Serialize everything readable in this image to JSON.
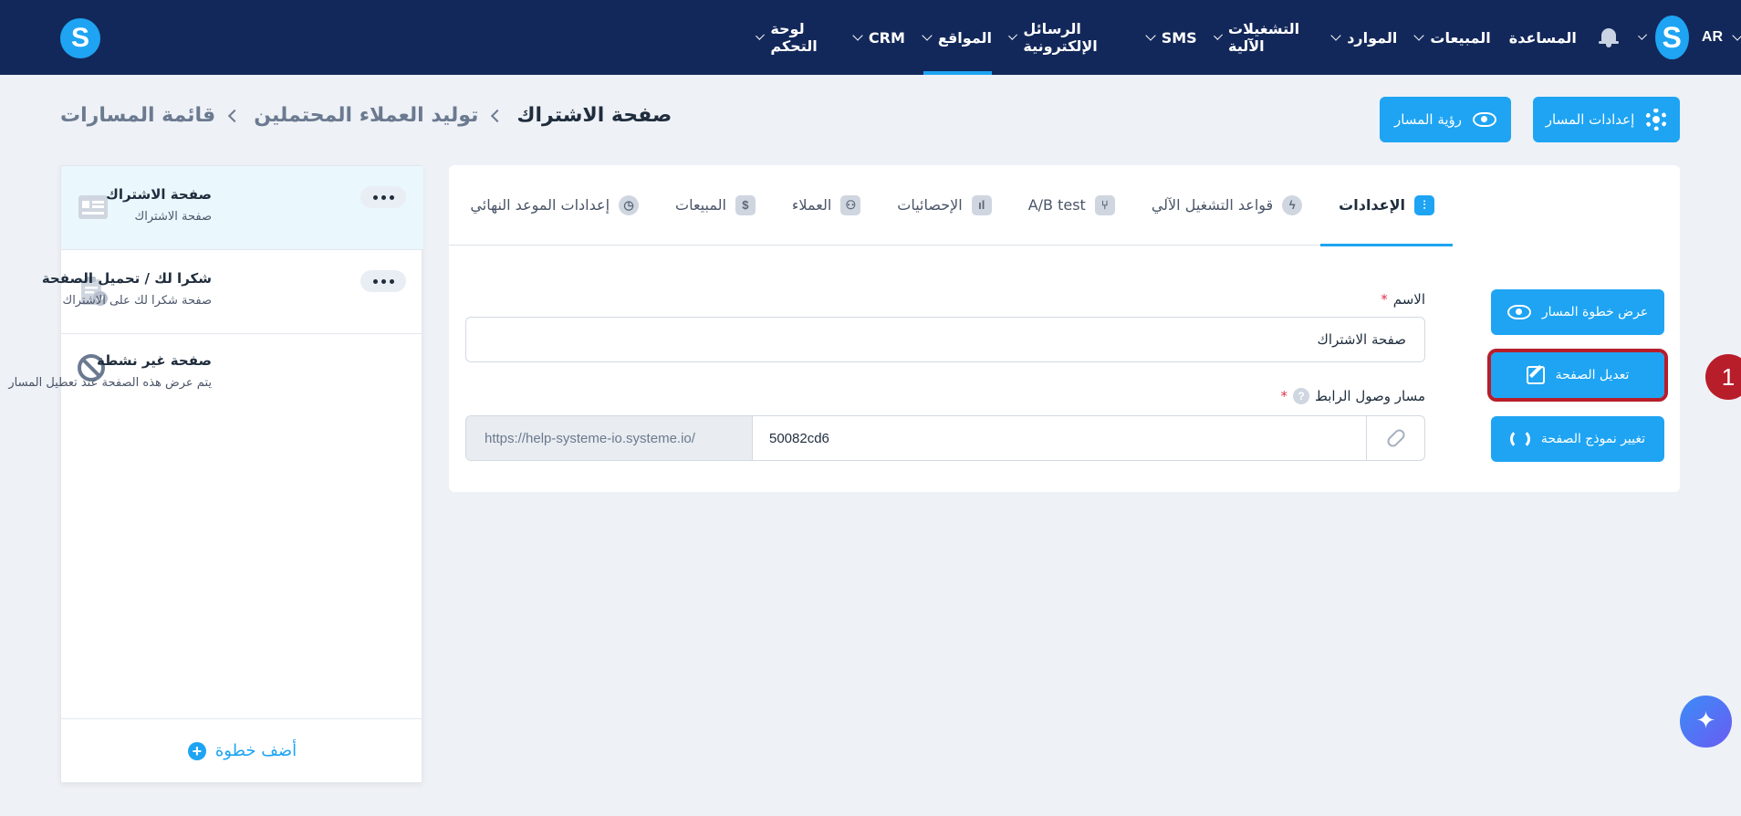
{
  "topbar": {
    "logo": "S",
    "nav": [
      {
        "label": "لوحة التحكم",
        "chevron": true
      },
      {
        "label": "CRM",
        "chevron": true
      },
      {
        "label": "المواقع",
        "chevron": true,
        "active": true
      },
      {
        "label": "الرسائل الإلكترونية",
        "chevron": true
      },
      {
        "label": "SMS",
        "chevron": true
      },
      {
        "label": "التشغيلات الآلية",
        "chevron": true
      },
      {
        "label": "الموارد",
        "chevron": true
      },
      {
        "label": "المبيعات",
        "chevron": true
      },
      {
        "label": "المساعدة",
        "chevron": false
      }
    ],
    "avatar": "S",
    "language": "AR"
  },
  "breadcrumb": {
    "items": [
      "قائمة المسارات",
      "توليد العملاء المحتملين",
      "صفحة الاشتراك"
    ]
  },
  "header_buttons": {
    "funnel_settings": "إعدادات المسار",
    "view_funnel": "رؤية المسار"
  },
  "steps": {
    "items": [
      {
        "title": "صفحة الاشتراك",
        "subtitle": "صفحة الاشتراك",
        "icon": "form-page-icon",
        "selected": true
      },
      {
        "title": "شكرا لك / تحميل الصفحة",
        "subtitle": "صفحة شكرا لك على الاشتراك",
        "icon": "clipboard-check-icon",
        "selected": false
      },
      {
        "title": "صفحة غير نشطة",
        "subtitle": "يتم عرض هذه الصفحة عند تعطيل المسار",
        "icon": "inactive-icon",
        "selected": false
      }
    ],
    "add_label": "أضف خطوة"
  },
  "tabs": {
    "items": [
      {
        "label": "الإعدادات",
        "icon": "settings-sliders-icon",
        "active": true
      },
      {
        "label": "قواعد التشغيل الآلي",
        "icon": "bolt-icon"
      },
      {
        "label": "A/B test",
        "icon": "split-icon"
      },
      {
        "label": "الإحصائيات",
        "icon": "stats-icon"
      },
      {
        "label": "العملاء",
        "icon": "users-icon"
      },
      {
        "label": "المبيعات",
        "icon": "dollar-icon"
      },
      {
        "label": "إعدادات الموعد النهائي",
        "icon": "clock-icon"
      }
    ]
  },
  "form": {
    "name_label": "الاسم",
    "name_value": "صفحة الاشتراك",
    "path_label": "مسار وصول الرابط",
    "url_prefix": "https://help-systeme-io.systeme.io/",
    "url_slug": "50082cd6"
  },
  "side_buttons": {
    "view_step": "عرض خطوة المسار",
    "edit_page": "تعديل الصفحة",
    "change_template": "تغيير نموذج الصفحة"
  },
  "annotation": {
    "number": "1"
  },
  "colors": {
    "nav_bg": "#13285a",
    "accent": "#1ea4f3",
    "highlight": "#b81d2a"
  }
}
